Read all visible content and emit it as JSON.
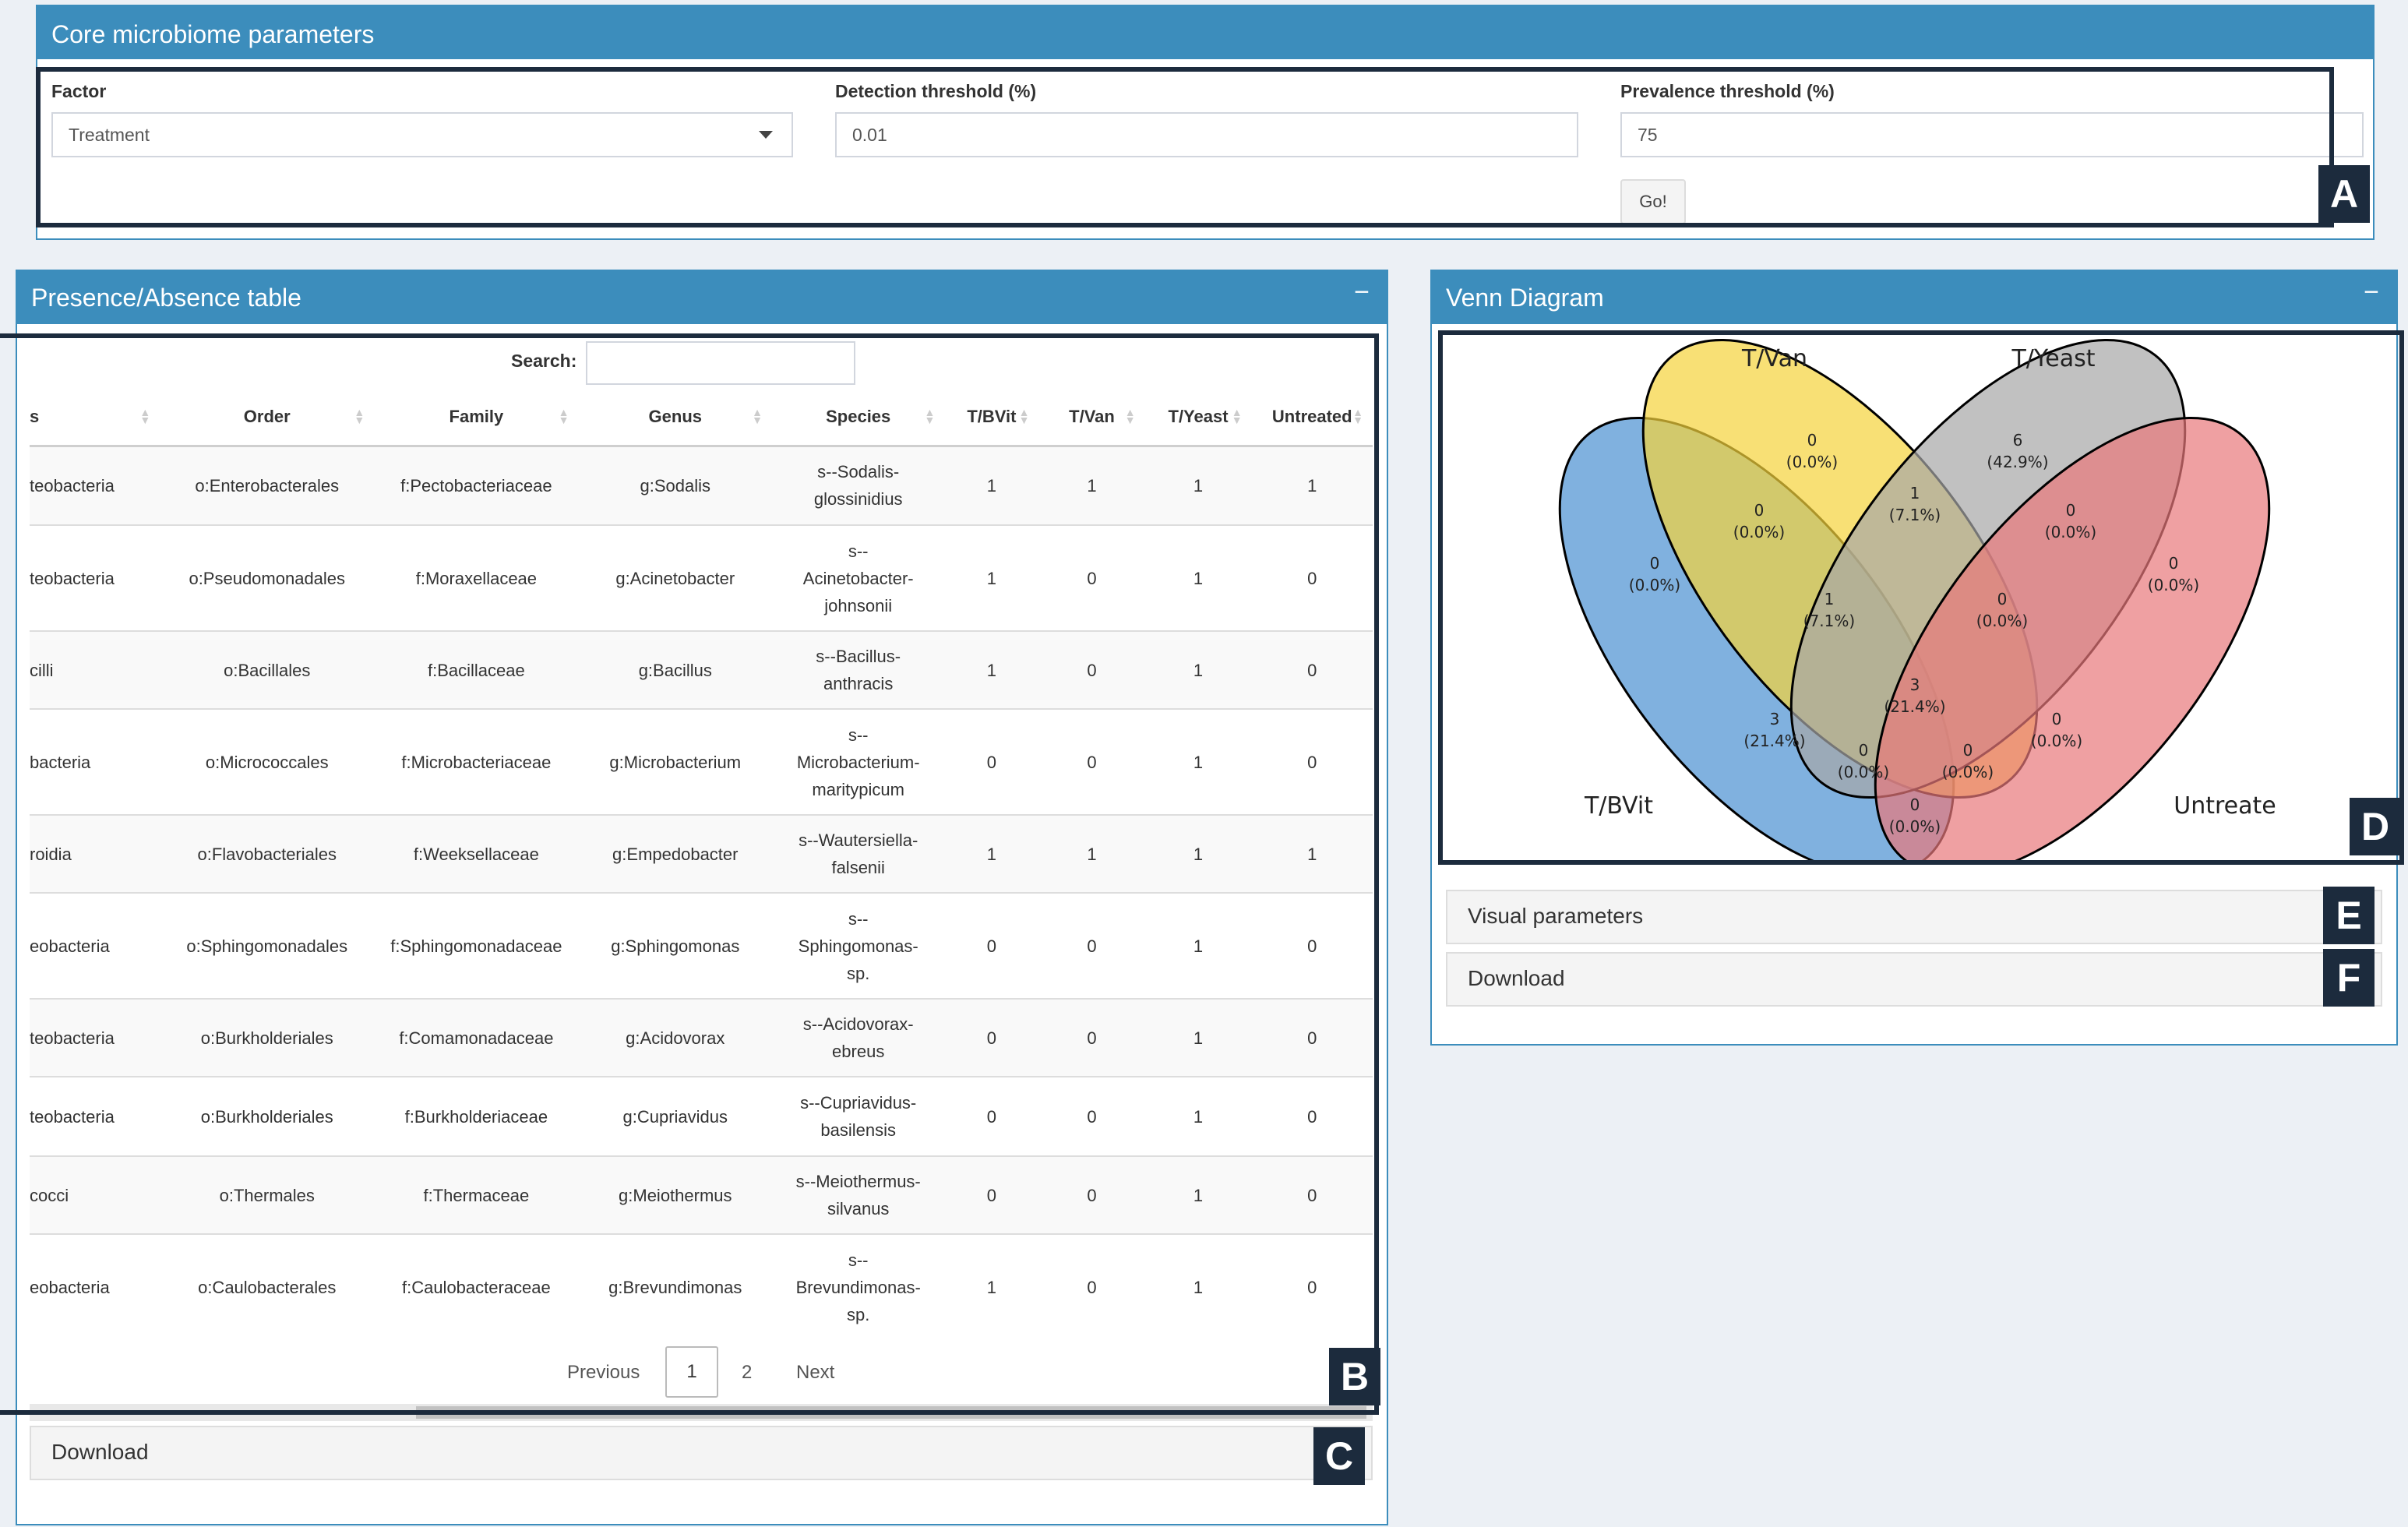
{
  "core_box": {
    "title": "Core microbiome parameters",
    "factor_label": "Factor",
    "factor_value": "Treatment",
    "detection_label": "Detection threshold (%)",
    "detection_value": "0.01",
    "prevalence_label": "Prevalence threshold (%)",
    "prevalence_value": "75",
    "go_label": "Go!"
  },
  "table_box": {
    "title": "Presence/Absence table",
    "collapse_label": "−",
    "search_label": "Search:",
    "search_value": "",
    "columns": [
      "s",
      "Order",
      "Family",
      "Genus",
      "Species",
      "T/BVit",
      "T/Van",
      "T/Yeast",
      "Untreated"
    ],
    "rows": [
      {
        "c0": "teobacteria",
        "order": "o:Enterobacterales",
        "family": "f:Pectobacteriaceae",
        "genus": "g:Sodalis",
        "species": "s--Sodalis-\nglossinidius",
        "tbvit": "1",
        "tvan": "1",
        "tyeast": "1",
        "untreated": "1"
      },
      {
        "c0": "teobacteria",
        "order": "o:Pseudomonadales",
        "family": "f:Moraxellaceae",
        "genus": "g:Acinetobacter",
        "species": "s--\nAcinetobacter-\njohnsonii",
        "tbvit": "1",
        "tvan": "0",
        "tyeast": "1",
        "untreated": "0"
      },
      {
        "c0": "cilli",
        "order": "o:Bacillales",
        "family": "f:Bacillaceae",
        "genus": "g:Bacillus",
        "species": "s--Bacillus-\nanthracis",
        "tbvit": "1",
        "tvan": "0",
        "tyeast": "1",
        "untreated": "0"
      },
      {
        "c0": "bacteria",
        "order": "o:Micrococcales",
        "family": "f:Microbacteriaceae",
        "genus": "g:Microbacterium",
        "species": "s--\nMicrobacterium-\nmaritypicum",
        "tbvit": "0",
        "tvan": "0",
        "tyeast": "1",
        "untreated": "0"
      },
      {
        "c0": "roidia",
        "order": "o:Flavobacteriales",
        "family": "f:Weeksellaceae",
        "genus": "g:Empedobacter",
        "species": "s--Wautersiella-\nfalsenii",
        "tbvit": "1",
        "tvan": "1",
        "tyeast": "1",
        "untreated": "1"
      },
      {
        "c0": "eobacteria",
        "order": "o:Sphingomonadales",
        "family": "f:Sphingomonadaceae",
        "genus": "g:Sphingomonas",
        "species": "s--\nSphingomonas-\nsp.",
        "tbvit": "0",
        "tvan": "0",
        "tyeast": "1",
        "untreated": "0"
      },
      {
        "c0": "teobacteria",
        "order": "o:Burkholderiales",
        "family": "f:Comamonadaceae",
        "genus": "g:Acidovorax",
        "species": "s--Acidovorax-\nebreus",
        "tbvit": "0",
        "tvan": "0",
        "tyeast": "1",
        "untreated": "0"
      },
      {
        "c0": "teobacteria",
        "order": "o:Burkholderiales",
        "family": "f:Burkholderiaceae",
        "genus": "g:Cupriavidus",
        "species": "s--Cupriavidus-\nbasilensis",
        "tbvit": "0",
        "tvan": "0",
        "tyeast": "1",
        "untreated": "0"
      },
      {
        "c0": "cocci",
        "order": "o:Thermales",
        "family": "f:Thermaceae",
        "genus": "g:Meiothermus",
        "species": "s--Meiothermus-\nsilvanus",
        "tbvit": "0",
        "tvan": "0",
        "tyeast": "1",
        "untreated": "0"
      },
      {
        "c0": "eobacteria",
        "order": "o:Caulobacterales",
        "family": "f:Caulobacteraceae",
        "genus": "g:Brevundimonas",
        "species": "s--\nBrevundimonas-\nsp.",
        "tbvit": "1",
        "tvan": "0",
        "tyeast": "1",
        "untreated": "0"
      }
    ],
    "pagination": {
      "previous": "Previous",
      "pages": [
        "1",
        "2"
      ],
      "next": "Next"
    },
    "download_label": "Download"
  },
  "venn_box": {
    "title": "Venn Diagram",
    "collapse_label": "−",
    "set_labels": {
      "tvan": "T/Van",
      "tyeast": "T/Yeast",
      "tbvit": "T/BVit",
      "untreated": "Untreate"
    },
    "colors": {
      "tbvit": "#4a90d2",
      "tvan": "#f5d33a",
      "tyeast": "#a6a6a6",
      "untreated": "#e8777a"
    },
    "regions": [
      {
        "id": "tvan_only",
        "count": "0",
        "pct": "(0.0%)"
      },
      {
        "id": "tyeast_only",
        "count": "6",
        "pct": "(42.9%)"
      },
      {
        "id": "tbvit_tvan",
        "count": "0",
        "pct": "(0.0%)"
      },
      {
        "id": "tvan_tyeast",
        "count": "1",
        "pct": "(7.1%)"
      },
      {
        "id": "tyeast_untreated",
        "count": "0",
        "pct": "(0.0%)"
      },
      {
        "id": "tbvit_only",
        "count": "0",
        "pct": "(0.0%)"
      },
      {
        "id": "untreated_only",
        "count": "0",
        "pct": "(0.0%)"
      },
      {
        "id": "tbvit_tvan_tyeast",
        "count": "1",
        "pct": "(7.1%)"
      },
      {
        "id": "tvan_tyeast_untreated",
        "count": "0",
        "pct": "(0.0%)"
      },
      {
        "id": "all",
        "count": "3",
        "pct": "(21.4%)"
      },
      {
        "id": "tbvit_tyeast",
        "count": "3",
        "pct": "(21.4%)"
      },
      {
        "id": "tvan_untreated",
        "count": "0",
        "pct": "(0.0%)"
      },
      {
        "id": "tbvit_tvan_untreated",
        "count": "0",
        "pct": "(0.0%)"
      },
      {
        "id": "tbvit_tyeast_untreated",
        "count": "0",
        "pct": "(0.0%)"
      },
      {
        "id": "tbvit_untreated",
        "count": "0",
        "pct": "(0.0%)"
      }
    ],
    "visual_params_label": "Visual parameters",
    "download_label": "Download"
  },
  "panel_tags": {
    "a": "A",
    "b": "B",
    "c": "C",
    "d": "D",
    "e": "E",
    "f": "F"
  }
}
